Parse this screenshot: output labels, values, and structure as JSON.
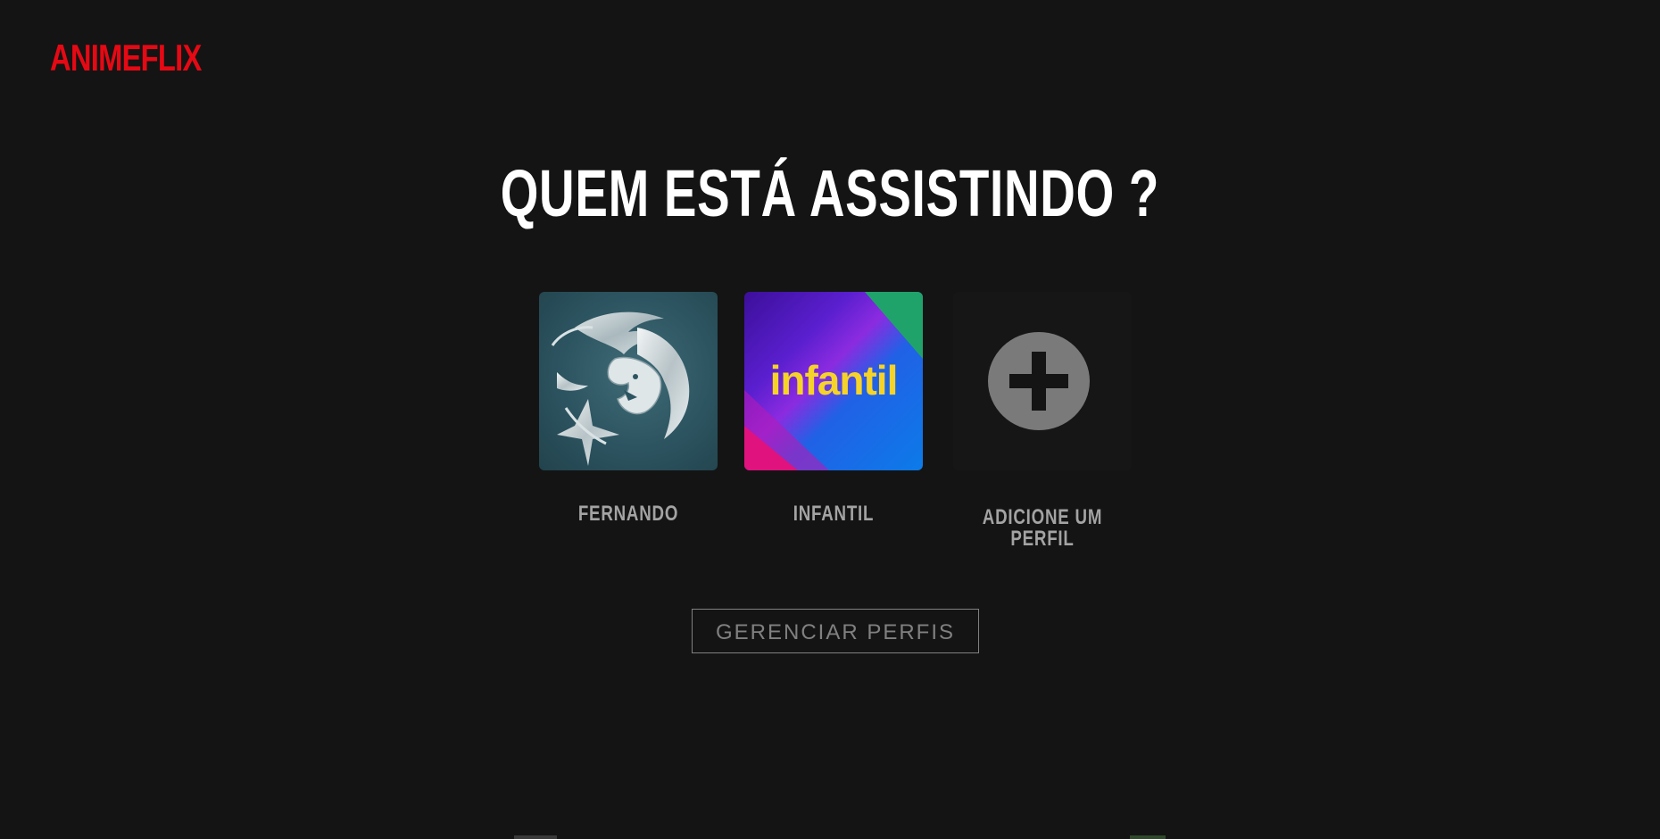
{
  "app": {
    "logo": "ANIMEFLIX"
  },
  "main": {
    "title": "QUEM ESTÁ ASSISTINDO ?",
    "profiles": [
      {
        "name": "FERNANDO",
        "avatar": "wolf-medallion-icon"
      },
      {
        "name": "INFANTIL",
        "avatar": "kids-icon",
        "avatar_text": "infantil"
      },
      {
        "name": "ADICIONE UM PERFIL",
        "avatar": "plus-circle-icon"
      }
    ],
    "manage_button": "GERENCIAR PERFIS"
  },
  "colors": {
    "background": "#141414",
    "brand": "#e50914",
    "muted": "#a3a3a3",
    "kids_text": "#f6d328"
  }
}
